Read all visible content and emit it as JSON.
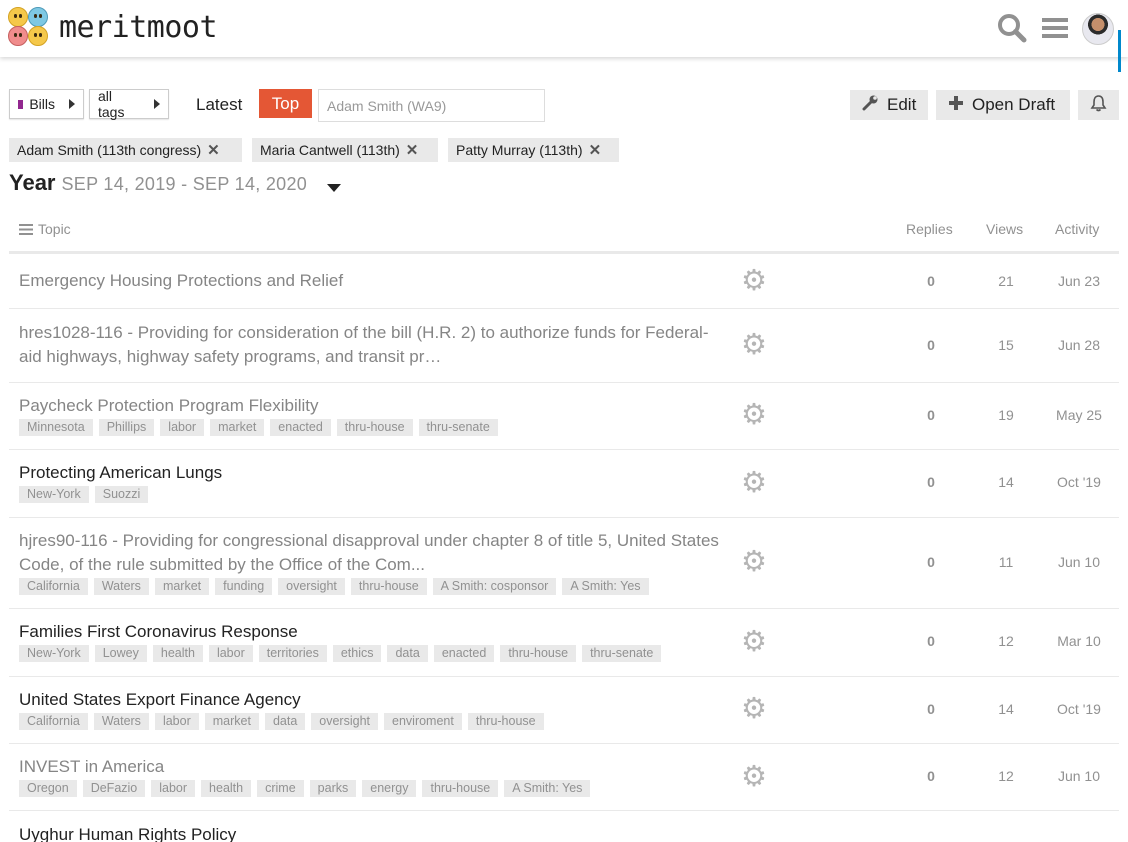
{
  "app": {
    "name": "meritmoot"
  },
  "nav": {
    "category": "Bills",
    "category_color": "#92278f",
    "tags": "all tags",
    "latest": "Latest",
    "top": "Top",
    "filter_placeholder": "Adam Smith (WA9)",
    "edit": "Edit",
    "open_draft": "Open Draft"
  },
  "chips": [
    "Adam Smith (113th congress)",
    "Maria Cantwell (113th)",
    "Patty Murray (113th)"
  ],
  "period": {
    "title": "Year",
    "range": "SEP 14, 2019 - SEP 14, 2020"
  },
  "table": {
    "topic": "Topic",
    "replies": "Replies",
    "views": "Views",
    "activity": "Activity"
  },
  "topics": [
    {
      "title": "Emergency Housing Protections and Relief",
      "tags": [],
      "replies": "0",
      "views": "21",
      "activity": "Jun 23",
      "unread": false
    },
    {
      "title": "hres1028-116 - Providing for consideration of the bill (H.R. 2) to authorize funds for Federal-aid highways, highway safety programs, and transit pr…",
      "tags": [],
      "replies": "0",
      "views": "15",
      "activity": "Jun 28",
      "unread": false
    },
    {
      "title": "Paycheck Protection Program Flexibility",
      "tags": [
        "Minnesota",
        "Phillips",
        "labor",
        "market",
        "enacted",
        "thru-house",
        "thru-senate"
      ],
      "replies": "0",
      "views": "19",
      "activity": "May 25",
      "unread": false
    },
    {
      "title": "Protecting American Lungs",
      "tags": [
        "New-York",
        "Suozzi"
      ],
      "replies": "0",
      "views": "14",
      "activity": "Oct '19",
      "unread": true
    },
    {
      "title": "hjres90-116 - Providing for congressional disapproval under chapter 8 of title 5, United States Code, of the rule submitted by the Office of the Com...",
      "tags": [
        "California",
        "Waters",
        "market",
        "funding",
        "oversight",
        "thru-house",
        "A Smith: cosponsor",
        "A Smith: Yes"
      ],
      "replies": "0",
      "views": "11",
      "activity": "Jun 10",
      "unread": false
    },
    {
      "title": "Families First Coronavirus Response",
      "tags": [
        "New-York",
        "Lowey",
        "health",
        "labor",
        "territories",
        "ethics",
        "data",
        "enacted",
        "thru-house",
        "thru-senate"
      ],
      "replies": "0",
      "views": "12",
      "activity": "Mar 10",
      "unread": true
    },
    {
      "title": "United States Export Finance Agency",
      "tags": [
        "California",
        "Waters",
        "labor",
        "market",
        "data",
        "oversight",
        "enviroment",
        "thru-house"
      ],
      "replies": "0",
      "views": "14",
      "activity": "Oct '19",
      "unread": true
    },
    {
      "title": "INVEST in America",
      "tags": [
        "Oregon",
        "DeFazio",
        "labor",
        "health",
        "crime",
        "parks",
        "energy",
        "thru-house",
        "A Smith: Yes"
      ],
      "replies": "0",
      "views": "12",
      "activity": "Jun 10",
      "unread": false
    },
    {
      "title": "Uyghur Human Rights Policy",
      "tags": [],
      "replies": "",
      "views": "",
      "activity": "",
      "unread": true
    }
  ]
}
